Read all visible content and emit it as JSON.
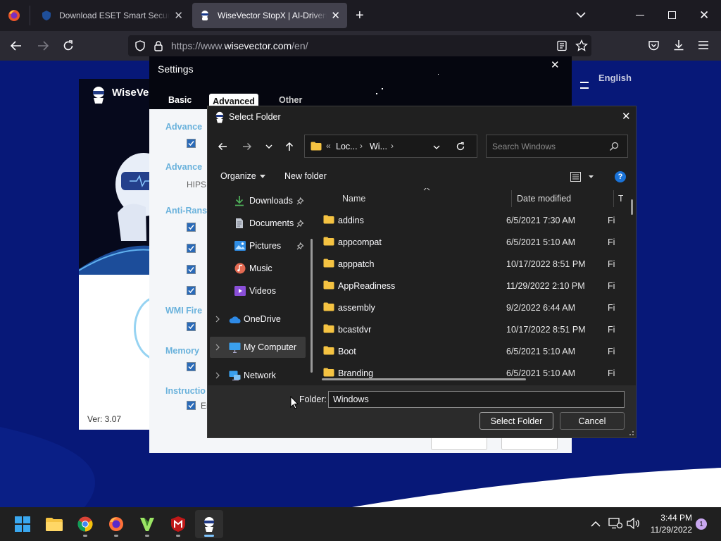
{
  "browser": {
    "tabs": [
      {
        "title": "Download ESET Smart Security Pre",
        "active": false
      },
      {
        "title": "WiseVector StopX | AI-Driven Malw",
        "active": true
      }
    ],
    "url_prefix": "https://www.",
    "url_host": "wisevector.com",
    "url_path": "/en/"
  },
  "wisevector_app": {
    "title": "WiseVec",
    "version": "Ver: 3.07",
    "language": "English"
  },
  "settings": {
    "title": "Settings",
    "tabs": [
      "Basic",
      "Advanced",
      "Other"
    ],
    "sections": [
      "Advance",
      "Advance",
      "Anti-Rans",
      "WMI Fire",
      "Memory",
      "Instructio"
    ],
    "hips_label": "HIPS",
    "partial_label": "En"
  },
  "dialog": {
    "title": "Select Folder",
    "breadcrumb": {
      "chevrons": "«",
      "part1": "Loc...",
      "part2": "Wi..."
    },
    "search_placeholder": "Search Windows",
    "organize_label": "Organize",
    "new_folder_label": "New folder",
    "help": "?",
    "nav": [
      {
        "label": "Downloads",
        "pinned": true
      },
      {
        "label": "Documents",
        "pinned": true
      },
      {
        "label": "Pictures",
        "pinned": true
      },
      {
        "label": "Music",
        "pinned": false
      },
      {
        "label": "Videos",
        "pinned": false
      },
      {
        "label": "OneDrive",
        "pinned": false
      },
      {
        "label": "My Computer",
        "pinned": false
      },
      {
        "label": "Network",
        "pinned": false
      }
    ],
    "columns": {
      "name": "Name",
      "date": "Date modified",
      "type": "Ty"
    },
    "files": [
      {
        "name": "addins",
        "date": "6/5/2021 7:30 AM",
        "type": "Fi"
      },
      {
        "name": "appcompat",
        "date": "6/5/2021 5:10 AM",
        "type": "Fi"
      },
      {
        "name": "apppatch",
        "date": "10/17/2022 8:51 PM",
        "type": "Fi"
      },
      {
        "name": "AppReadiness",
        "date": "11/29/2022 2:10 PM",
        "type": "Fi"
      },
      {
        "name": "assembly",
        "date": "9/2/2022 6:44 AM",
        "type": "Fi"
      },
      {
        "name": "bcastdvr",
        "date": "10/17/2022 8:51 PM",
        "type": "Fi"
      },
      {
        "name": "Boot",
        "date": "6/5/2021 5:10 AM",
        "type": "Fi"
      },
      {
        "name": "Branding",
        "date": "6/5/2021 5:10 AM",
        "type": "Fi"
      }
    ],
    "folder_label": "Folder:",
    "folder_value": "Windows",
    "select_button": "Select Folder",
    "cancel_button": "Cancel"
  },
  "taskbar": {
    "time": "3:44 PM",
    "date": "11/29/2022",
    "notification_count": "1"
  },
  "colors": {
    "accent": "#0078d4",
    "dialog_bg": "#202020",
    "page_bg": "#081a7a",
    "folder": "#f5c342"
  }
}
